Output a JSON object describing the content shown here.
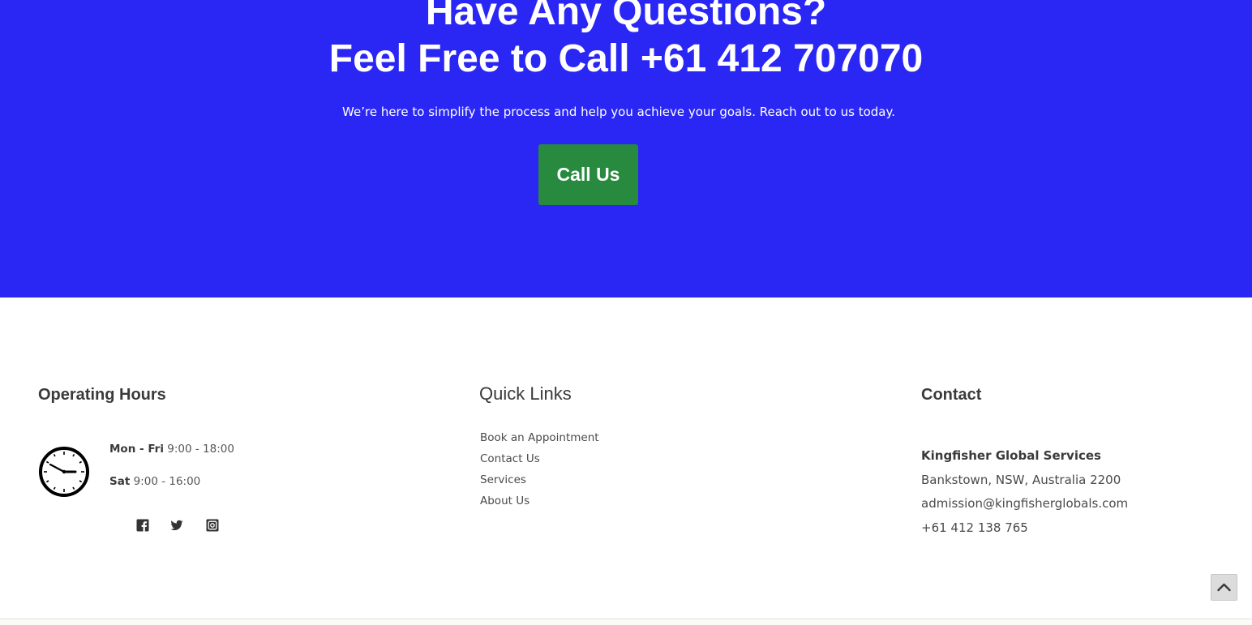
{
  "hero": {
    "title_line1": "Have Any Questions?",
    "title_line2": "Feel Free to Call +61 412 707070",
    "subtitle": "We’re here to simplify the process and help you achieve your goals. Reach out to us today.",
    "button_label": "Call Us",
    "background_color": "#2a27f5",
    "button_color": "#278a3e"
  },
  "footer": {
    "operating_hours": {
      "title": "Operating Hours",
      "icon": "clock-icon",
      "rows": [
        {
          "day": "Mon - Fri",
          "time": "9:00 - 18:00"
        },
        {
          "day": "Sat",
          "time": "9:00 - 16:00"
        }
      ],
      "social": [
        "facebook-icon",
        "twitter-icon",
        "instagram-icon"
      ]
    },
    "quick_links": {
      "title": "Quick Links",
      "items": [
        "Book an Appointment",
        "Contact Us",
        "Services",
        "About Us"
      ]
    },
    "contact": {
      "title": "Contact",
      "company": "Kingfisher Global Services",
      "address": "Bankstown, NSW, Australia 2200",
      "email": "admission@kingfisherglobals.com",
      "phone": "+61 412 138 765"
    },
    "scroll_top_icon": "chevron-up-icon"
  }
}
